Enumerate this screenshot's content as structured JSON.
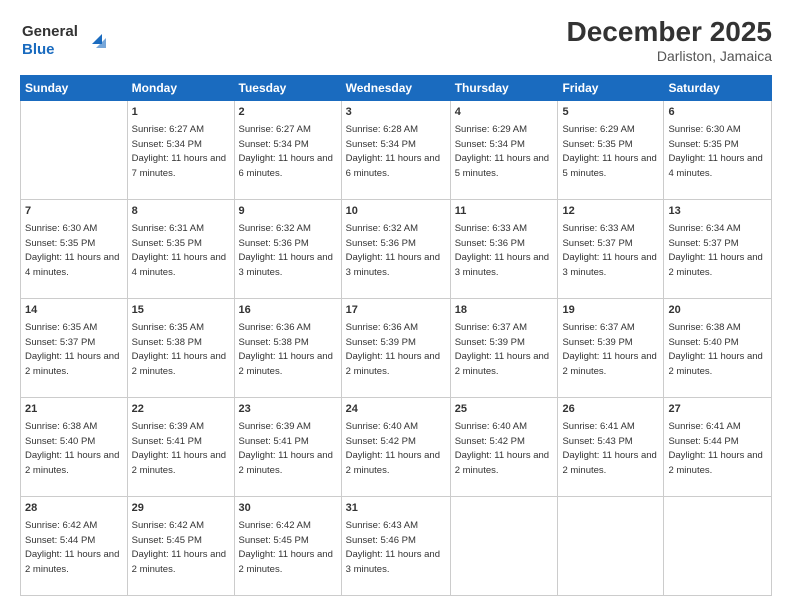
{
  "logo": {
    "line1": "General",
    "line2": "Blue"
  },
  "title": "December 2025",
  "location": "Darliston, Jamaica",
  "days_of_week": [
    "Sunday",
    "Monday",
    "Tuesday",
    "Wednesday",
    "Thursday",
    "Friday",
    "Saturday"
  ],
  "weeks": [
    [
      {
        "num": "",
        "sunrise": "",
        "sunset": "",
        "daylight": ""
      },
      {
        "num": "1",
        "sunrise": "Sunrise: 6:27 AM",
        "sunset": "Sunset: 5:34 PM",
        "daylight": "Daylight: 11 hours and 7 minutes."
      },
      {
        "num": "2",
        "sunrise": "Sunrise: 6:27 AM",
        "sunset": "Sunset: 5:34 PM",
        "daylight": "Daylight: 11 hours and 6 minutes."
      },
      {
        "num": "3",
        "sunrise": "Sunrise: 6:28 AM",
        "sunset": "Sunset: 5:34 PM",
        "daylight": "Daylight: 11 hours and 6 minutes."
      },
      {
        "num": "4",
        "sunrise": "Sunrise: 6:29 AM",
        "sunset": "Sunset: 5:34 PM",
        "daylight": "Daylight: 11 hours and 5 minutes."
      },
      {
        "num": "5",
        "sunrise": "Sunrise: 6:29 AM",
        "sunset": "Sunset: 5:35 PM",
        "daylight": "Daylight: 11 hours and 5 minutes."
      },
      {
        "num": "6",
        "sunrise": "Sunrise: 6:30 AM",
        "sunset": "Sunset: 5:35 PM",
        "daylight": "Daylight: 11 hours and 4 minutes."
      }
    ],
    [
      {
        "num": "7",
        "sunrise": "Sunrise: 6:30 AM",
        "sunset": "Sunset: 5:35 PM",
        "daylight": "Daylight: 11 hours and 4 minutes."
      },
      {
        "num": "8",
        "sunrise": "Sunrise: 6:31 AM",
        "sunset": "Sunset: 5:35 PM",
        "daylight": "Daylight: 11 hours and 4 minutes."
      },
      {
        "num": "9",
        "sunrise": "Sunrise: 6:32 AM",
        "sunset": "Sunset: 5:36 PM",
        "daylight": "Daylight: 11 hours and 3 minutes."
      },
      {
        "num": "10",
        "sunrise": "Sunrise: 6:32 AM",
        "sunset": "Sunset: 5:36 PM",
        "daylight": "Daylight: 11 hours and 3 minutes."
      },
      {
        "num": "11",
        "sunrise": "Sunrise: 6:33 AM",
        "sunset": "Sunset: 5:36 PM",
        "daylight": "Daylight: 11 hours and 3 minutes."
      },
      {
        "num": "12",
        "sunrise": "Sunrise: 6:33 AM",
        "sunset": "Sunset: 5:37 PM",
        "daylight": "Daylight: 11 hours and 3 minutes."
      },
      {
        "num": "13",
        "sunrise": "Sunrise: 6:34 AM",
        "sunset": "Sunset: 5:37 PM",
        "daylight": "Daylight: 11 hours and 2 minutes."
      }
    ],
    [
      {
        "num": "14",
        "sunrise": "Sunrise: 6:35 AM",
        "sunset": "Sunset: 5:37 PM",
        "daylight": "Daylight: 11 hours and 2 minutes."
      },
      {
        "num": "15",
        "sunrise": "Sunrise: 6:35 AM",
        "sunset": "Sunset: 5:38 PM",
        "daylight": "Daylight: 11 hours and 2 minutes."
      },
      {
        "num": "16",
        "sunrise": "Sunrise: 6:36 AM",
        "sunset": "Sunset: 5:38 PM",
        "daylight": "Daylight: 11 hours and 2 minutes."
      },
      {
        "num": "17",
        "sunrise": "Sunrise: 6:36 AM",
        "sunset": "Sunset: 5:39 PM",
        "daylight": "Daylight: 11 hours and 2 minutes."
      },
      {
        "num": "18",
        "sunrise": "Sunrise: 6:37 AM",
        "sunset": "Sunset: 5:39 PM",
        "daylight": "Daylight: 11 hours and 2 minutes."
      },
      {
        "num": "19",
        "sunrise": "Sunrise: 6:37 AM",
        "sunset": "Sunset: 5:39 PM",
        "daylight": "Daylight: 11 hours and 2 minutes."
      },
      {
        "num": "20",
        "sunrise": "Sunrise: 6:38 AM",
        "sunset": "Sunset: 5:40 PM",
        "daylight": "Daylight: 11 hours and 2 minutes."
      }
    ],
    [
      {
        "num": "21",
        "sunrise": "Sunrise: 6:38 AM",
        "sunset": "Sunset: 5:40 PM",
        "daylight": "Daylight: 11 hours and 2 minutes."
      },
      {
        "num": "22",
        "sunrise": "Sunrise: 6:39 AM",
        "sunset": "Sunset: 5:41 PM",
        "daylight": "Daylight: 11 hours and 2 minutes."
      },
      {
        "num": "23",
        "sunrise": "Sunrise: 6:39 AM",
        "sunset": "Sunset: 5:41 PM",
        "daylight": "Daylight: 11 hours and 2 minutes."
      },
      {
        "num": "24",
        "sunrise": "Sunrise: 6:40 AM",
        "sunset": "Sunset: 5:42 PM",
        "daylight": "Daylight: 11 hours and 2 minutes."
      },
      {
        "num": "25",
        "sunrise": "Sunrise: 6:40 AM",
        "sunset": "Sunset: 5:42 PM",
        "daylight": "Daylight: 11 hours and 2 minutes."
      },
      {
        "num": "26",
        "sunrise": "Sunrise: 6:41 AM",
        "sunset": "Sunset: 5:43 PM",
        "daylight": "Daylight: 11 hours and 2 minutes."
      },
      {
        "num": "27",
        "sunrise": "Sunrise: 6:41 AM",
        "sunset": "Sunset: 5:44 PM",
        "daylight": "Daylight: 11 hours and 2 minutes."
      }
    ],
    [
      {
        "num": "28",
        "sunrise": "Sunrise: 6:42 AM",
        "sunset": "Sunset: 5:44 PM",
        "daylight": "Daylight: 11 hours and 2 minutes."
      },
      {
        "num": "29",
        "sunrise": "Sunrise: 6:42 AM",
        "sunset": "Sunset: 5:45 PM",
        "daylight": "Daylight: 11 hours and 2 minutes."
      },
      {
        "num": "30",
        "sunrise": "Sunrise: 6:42 AM",
        "sunset": "Sunset: 5:45 PM",
        "daylight": "Daylight: 11 hours and 2 minutes."
      },
      {
        "num": "31",
        "sunrise": "Sunrise: 6:43 AM",
        "sunset": "Sunset: 5:46 PM",
        "daylight": "Daylight: 11 hours and 3 minutes."
      },
      {
        "num": "",
        "sunrise": "",
        "sunset": "",
        "daylight": ""
      },
      {
        "num": "",
        "sunrise": "",
        "sunset": "",
        "daylight": ""
      },
      {
        "num": "",
        "sunrise": "",
        "sunset": "",
        "daylight": ""
      }
    ]
  ]
}
